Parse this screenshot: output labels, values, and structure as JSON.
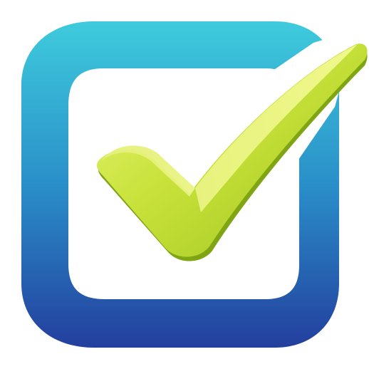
{
  "icon": {
    "name": "checkbox-checked-icon",
    "colors": {
      "frame_top": "#3ecbdc",
      "frame_mid": "#2a8fc9",
      "frame_bottom": "#233f9e",
      "inner": "#ffffff",
      "check_light": "#eaf57a",
      "check_mid": "#c8e23a",
      "check_dark": "#9cc21e",
      "check_shadow": "#7fa515"
    }
  }
}
